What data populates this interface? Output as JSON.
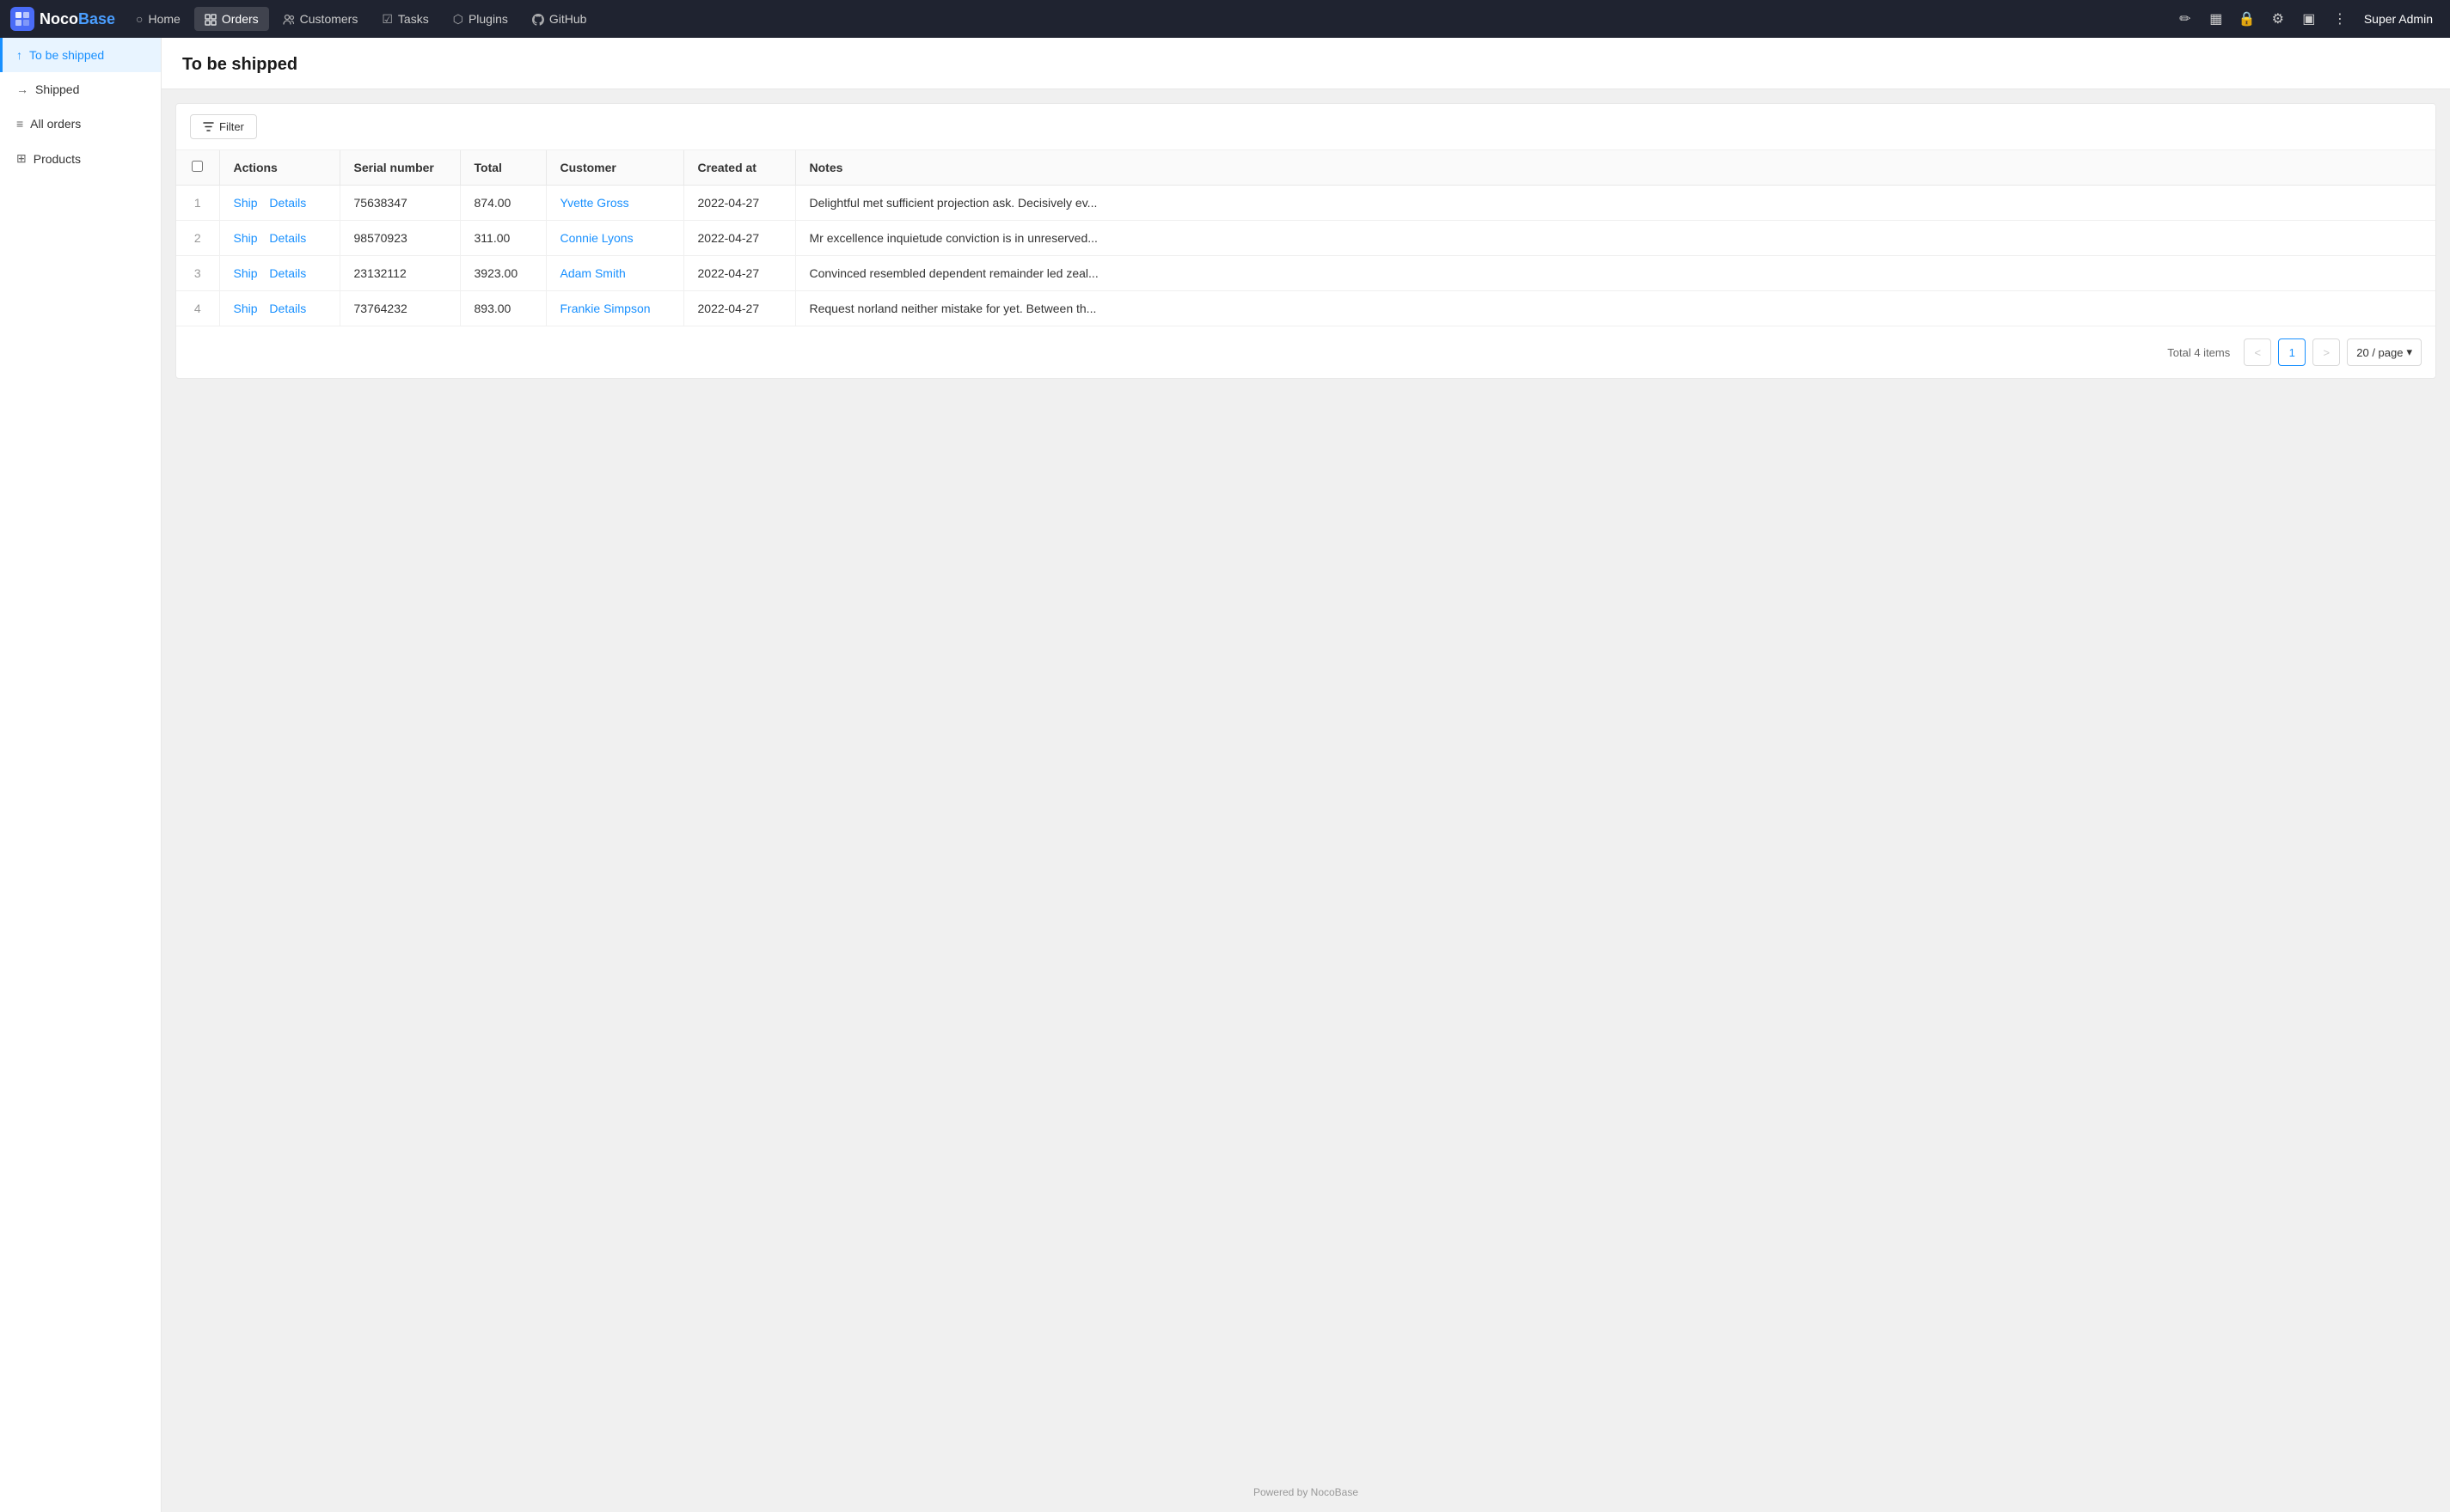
{
  "logo": {
    "noco": "Noco",
    "base": "Base",
    "icon": "🔷"
  },
  "nav": {
    "items": [
      {
        "id": "home",
        "label": "Home",
        "icon": "○"
      },
      {
        "id": "orders",
        "label": "Orders",
        "icon": "▦",
        "active": true
      },
      {
        "id": "customers",
        "label": "Customers",
        "icon": "👤"
      },
      {
        "id": "tasks",
        "label": "Tasks",
        "icon": "☑"
      },
      {
        "id": "plugins",
        "label": "Plugins",
        "icon": "⬡"
      },
      {
        "id": "github",
        "label": "GitHub",
        "icon": "⊙"
      }
    ],
    "right_icons": [
      "✏",
      "▦",
      "🔒",
      "⚙",
      "▣",
      "⋮"
    ],
    "admin_label": "Super Admin"
  },
  "sidebar": {
    "items": [
      {
        "id": "to-be-shipped",
        "label": "To be shipped",
        "icon": "↑",
        "active": true
      },
      {
        "id": "shipped",
        "label": "Shipped",
        "icon": "→"
      },
      {
        "id": "all-orders",
        "label": "All orders",
        "icon": "≡"
      },
      {
        "id": "products",
        "label": "Products",
        "icon": "⊞"
      }
    ]
  },
  "page": {
    "title": "To be shipped"
  },
  "toolbar": {
    "filter_label": "Filter"
  },
  "table": {
    "columns": [
      {
        "id": "actions",
        "label": "Actions"
      },
      {
        "id": "serial",
        "label": "Serial number"
      },
      {
        "id": "total",
        "label": "Total"
      },
      {
        "id": "customer",
        "label": "Customer"
      },
      {
        "id": "created_at",
        "label": "Created at"
      },
      {
        "id": "notes",
        "label": "Notes"
      }
    ],
    "rows": [
      {
        "index": 1,
        "serial": "75638347",
        "total": "874.00",
        "customer": "Yvette Gross",
        "created_at": "2022-04-27",
        "notes": "Delightful met sufficient projection ask. Decisively ev...",
        "actions": [
          "Ship",
          "Details"
        ]
      },
      {
        "index": 2,
        "serial": "98570923",
        "total": "311.00",
        "customer": "Connie Lyons",
        "created_at": "2022-04-27",
        "notes": "Mr excellence inquietude conviction is in unreserved...",
        "actions": [
          "Ship",
          "Details"
        ]
      },
      {
        "index": 3,
        "serial": "23132112",
        "total": "3923.00",
        "customer": "Adam Smith",
        "created_at": "2022-04-27",
        "notes": "Convinced resembled dependent remainder led zeal...",
        "actions": [
          "Ship",
          "Details"
        ]
      },
      {
        "index": 4,
        "serial": "73764232",
        "total": "893.00",
        "customer": "Frankie Simpson",
        "created_at": "2022-04-27",
        "notes": "Request norland neither mistake for yet. Between th...",
        "actions": [
          "Ship",
          "Details"
        ]
      }
    ]
  },
  "pagination": {
    "total_text": "Total 4 items",
    "current_page": "1",
    "page_size": "20 / page",
    "prev_icon": "<",
    "next_icon": ">"
  },
  "footer": {
    "text": "Powered by NocoBase"
  }
}
